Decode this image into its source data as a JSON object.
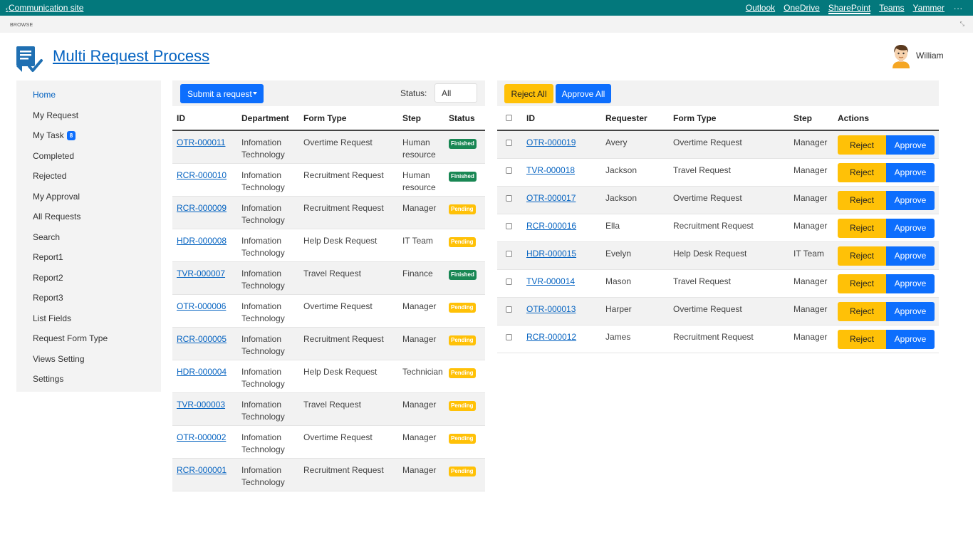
{
  "suitebar": {
    "site_link": "Communication site",
    "links": [
      "Outlook",
      "OneDrive",
      "SharePoint",
      "Teams",
      "Yammer"
    ],
    "active_link": "SharePoint",
    "more": "..."
  },
  "ribbon": {
    "browse": "BROWSE"
  },
  "header": {
    "title": "Multi Request Process",
    "user_name": "William"
  },
  "sidebar": {
    "items": [
      {
        "label": "Home"
      },
      {
        "label": "My Request"
      },
      {
        "label": "My Task",
        "badge": "8"
      },
      {
        "label": "Completed"
      },
      {
        "label": "Rejected"
      },
      {
        "label": "My Approval"
      },
      {
        "label": "All Requests"
      },
      {
        "label": "Search"
      },
      {
        "label": "Report1"
      },
      {
        "label": "Report2"
      },
      {
        "label": "Report3"
      },
      {
        "label": "List Fields"
      },
      {
        "label": "Request Form Type"
      },
      {
        "label": "Views Setting"
      },
      {
        "label": "Settings"
      }
    ],
    "active": "Home"
  },
  "left": {
    "submit_label": "Submit a request",
    "status_label": "Status:",
    "status_value": "All",
    "columns": [
      "ID",
      "Department",
      "Form Type",
      "Step",
      "Status"
    ],
    "rows": [
      {
        "id": "OTR-000011",
        "dept1": "Infomation",
        "dept2": "Technology",
        "form": "Overtime Request",
        "step1": "Human",
        "step2": "resource",
        "status": "Finished"
      },
      {
        "id": "RCR-000010",
        "dept1": "Infomation",
        "dept2": "Technology",
        "form": "Recruitment Request",
        "step1": "Human",
        "step2": "resource",
        "status": "Finished"
      },
      {
        "id": "RCR-000009",
        "dept1": "Infomation",
        "dept2": "Technology",
        "form": "Recruitment Request",
        "step1": "Manager",
        "step2": "",
        "status": "Pending"
      },
      {
        "id": "HDR-000008",
        "dept1": "Infomation",
        "dept2": "Technology",
        "form": "Help Desk Request",
        "step1": "IT Team",
        "step2": "",
        "status": "Pending"
      },
      {
        "id": "TVR-000007",
        "dept1": "Infomation",
        "dept2": "Technology",
        "form": "Travel Request",
        "step1": "Finance",
        "step2": "",
        "status": "Finished"
      },
      {
        "id": "OTR-000006",
        "dept1": "Infomation",
        "dept2": "Technology",
        "form": "Overtime Request",
        "step1": "Manager",
        "step2": "",
        "status": "Pending"
      },
      {
        "id": "RCR-000005",
        "dept1": "Infomation",
        "dept2": "Technology",
        "form": "Recruitment Request",
        "step1": "Manager",
        "step2": "",
        "status": "Pending"
      },
      {
        "id": "HDR-000004",
        "dept1": "Infomation",
        "dept2": "Technology",
        "form": "Help Desk Request",
        "step1": "Technician",
        "step2": "",
        "status": "Pending"
      },
      {
        "id": "TVR-000003",
        "dept1": "Infomation",
        "dept2": "Technology",
        "form": "Travel Request",
        "step1": "Manager",
        "step2": "",
        "status": "Pending"
      },
      {
        "id": "OTR-000002",
        "dept1": "Infomation",
        "dept2": "Technology",
        "form": "Overtime Request",
        "step1": "Manager",
        "step2": "",
        "status": "Pending"
      },
      {
        "id": "RCR-000001",
        "dept1": "Infomation",
        "dept2": "Technology",
        "form": "Recruitment Request",
        "step1": "Manager",
        "step2": "",
        "status": "Pending"
      }
    ]
  },
  "right": {
    "reject_all_label": "Reject All",
    "approve_all_label": "Approve All",
    "columns": [
      "ID",
      "Requester",
      "Form Type",
      "Step",
      "Actions"
    ],
    "reject_label": "Reject",
    "approve_label": "Approve",
    "rows": [
      {
        "id": "OTR-000019",
        "requester": "Avery",
        "form": "Overtime Request",
        "step": "Manager"
      },
      {
        "id": "TVR-000018",
        "requester": "Jackson",
        "form": "Travel Request",
        "step": "Manager"
      },
      {
        "id": "OTR-000017",
        "requester": "Jackson",
        "form": "Overtime Request",
        "step": "Manager"
      },
      {
        "id": "RCR-000016",
        "requester": "Ella",
        "form": "Recruitment Request",
        "step": "Manager"
      },
      {
        "id": "HDR-000015",
        "requester": "Evelyn",
        "form": "Help Desk Request",
        "step": "IT Team"
      },
      {
        "id": "TVR-000014",
        "requester": "Mason",
        "form": "Travel Request",
        "step": "Manager"
      },
      {
        "id": "OTR-000013",
        "requester": "Harper",
        "form": "Overtime Request",
        "step": "Manager"
      },
      {
        "id": "RCR-000012",
        "requester": "James",
        "form": "Recruitment Request",
        "step": "Manager"
      }
    ]
  },
  "colors": {
    "suitebar": "#03787c",
    "primary": "#0d6efd",
    "warning": "#ffc107",
    "success": "#198754",
    "link": "#0563c1"
  }
}
